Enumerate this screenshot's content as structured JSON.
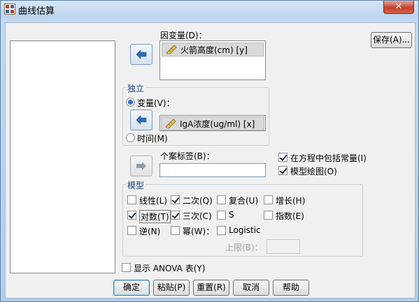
{
  "window": {
    "title": "曲线估算",
    "close_label": "✕"
  },
  "dependent": {
    "label": "因变量(D)：",
    "variable": "火箭高度(cm) [y]"
  },
  "independent": {
    "group_title": "独立",
    "variable_radio_label": "变量(V)：",
    "variable": "IgA浓度(ug/ml) [x]",
    "time_radio_label": "时间(M)",
    "selected": "variable"
  },
  "case_label": {
    "label": "个案标签(B)：",
    "value": ""
  },
  "options": {
    "include_constant_label": "在方程中包括常量(I)",
    "include_constant": true,
    "plot_models_label": "模型绘图(O)",
    "plot_models": true
  },
  "models": {
    "group_title": "模型",
    "items": [
      {
        "label": "线性(L)",
        "checked": false
      },
      {
        "label": "二次(Q)",
        "checked": true
      },
      {
        "label": "复合(U)",
        "checked": false
      },
      {
        "label": "增长(H)",
        "checked": false
      },
      {
        "label": "对数(T)",
        "checked": true
      },
      {
        "label": "三次(C)",
        "checked": true
      },
      {
        "label": "S",
        "checked": false
      },
      {
        "label": "指数(E)",
        "checked": false
      },
      {
        "label": "逆(N)",
        "checked": false
      },
      {
        "label": "幂(W)：",
        "checked": false
      },
      {
        "label": "Logistic",
        "checked": false
      }
    ],
    "upper_limit_label": "上限(B)：",
    "upper_limit_value": ""
  },
  "anova": {
    "label": "显示 ANOVA 表(Y)",
    "checked": false
  },
  "buttons": {
    "save": "保存(A)...",
    "ok": "确定",
    "paste": "粘贴(P)",
    "reset": "重置(R)",
    "cancel": "取消",
    "help": "帮助"
  }
}
